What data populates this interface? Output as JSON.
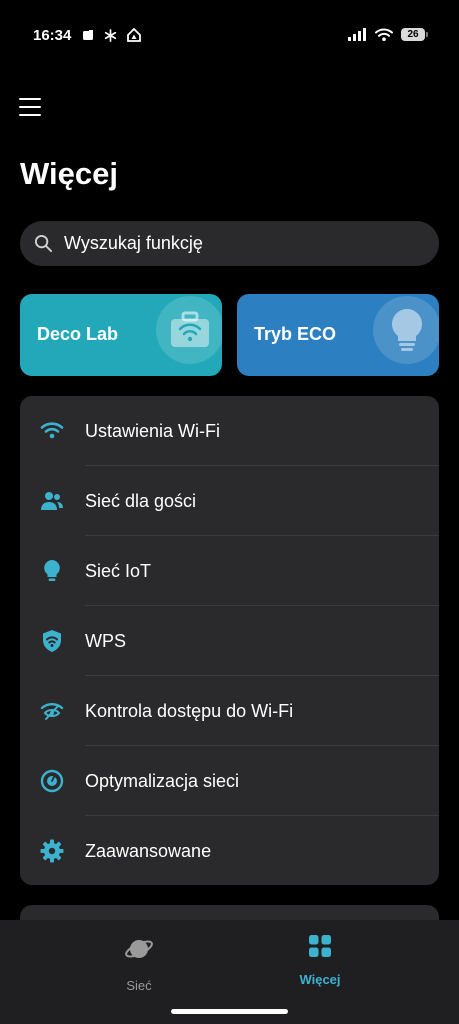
{
  "status": {
    "time": "16:34",
    "battery": "26"
  },
  "header": {
    "title": "Więcej"
  },
  "search": {
    "placeholder": "Wyszukaj funkcję"
  },
  "tiles": [
    {
      "label": "Deco Lab",
      "icon": "toolbox-wifi-icon"
    },
    {
      "label": "Tryb ECO",
      "icon": "lightbulb-icon"
    }
  ],
  "menu": {
    "items": [
      {
        "label": "Ustawienia Wi-Fi",
        "icon": "wifi-icon"
      },
      {
        "label": "Sieć dla gości",
        "icon": "guests-icon"
      },
      {
        "label": "Sieć IoT",
        "icon": "bulb-icon"
      },
      {
        "label": "WPS",
        "icon": "shield-wifi-icon"
      },
      {
        "label": "Kontrola dostępu do Wi-Fi",
        "icon": "wifi-eye-icon"
      },
      {
        "label": "Optymalizacja sieci",
        "icon": "optimize-icon"
      },
      {
        "label": "Zaawansowane",
        "icon": "gear-icon"
      }
    ]
  },
  "tabbar": {
    "tabs": [
      {
        "label": "Sieć",
        "icon": "planet-icon",
        "active": false
      },
      {
        "label": "Więcej",
        "icon": "grid-icon",
        "active": true
      }
    ]
  },
  "colors": {
    "accent": "#3db2cf",
    "deco_lab_bg": "#22a8b8",
    "eco_bg": "#2c7fc0",
    "card_bg": "#2a2a2c"
  }
}
